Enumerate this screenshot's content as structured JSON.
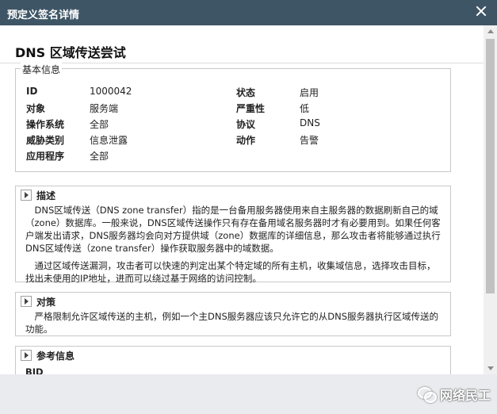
{
  "window": {
    "title": "预定义签名详情"
  },
  "signature": {
    "title": "DNS 区域传送尝试"
  },
  "basic_info": {
    "legend": "基本信息",
    "fields": [
      {
        "key": "ID",
        "value": "1000042"
      },
      {
        "key": "对象",
        "value": "服务端"
      },
      {
        "key": "操作系统",
        "value": "全部"
      },
      {
        "key": "威胁类别",
        "value": "信息泄露"
      },
      {
        "key": "应用程序",
        "value": "全部"
      },
      {
        "key": "状态",
        "value": "启用"
      },
      {
        "key": "严重性",
        "value": "低"
      },
      {
        "key": "协议",
        "value": "DNS"
      },
      {
        "key": "动作",
        "value": "告警"
      }
    ]
  },
  "description": {
    "label": "描述",
    "para1_lines": [
      "　DNS区域传送（DNS zone transfer）指的是一台备用服务器使用来自主服务器的数据刷新自己的域",
      "（zone）数据库。一般来说，DNS区域传送操作只有存在备用域名服务器时才有必要用到。如果任何客",
      "户端发出请求，DNS服务器均会向对方提供域（zone）数据库的详细信息，那么攻击者将能够通过执行",
      "DNS区域传送（zone transfer）操作获取服务器中的域数据。"
    ],
    "para2_lines": [
      "　通过区域传送漏洞，攻击者可以快速的判定出某个特定域的所有主机，收集域信息，选择攻击目标，",
      "找出未使用的IP地址，进而可以绕过基于网络的访问控制。"
    ]
  },
  "countermeasure": {
    "label": "对策",
    "lines": [
      "　严格限制允许区域传送的主机，例如一个主DNS服务器应该只允许它的从DNS服务器执行区域传送的",
      "功能。"
    ]
  },
  "reference": {
    "label": "参考信息",
    "first_key": "BID"
  },
  "watermark": {
    "text": "网络民工"
  }
}
